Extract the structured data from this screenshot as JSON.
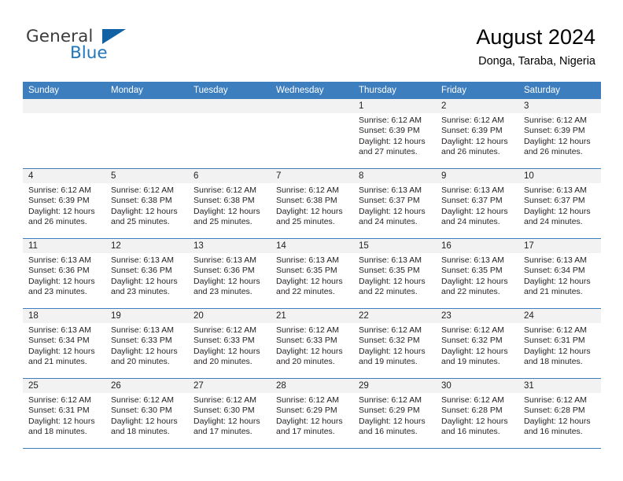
{
  "brand": {
    "name_top": "General",
    "name_bottom": "Blue",
    "triangle_icon": "blue-triangle-logo-mark",
    "color_top": "#3c3c3c",
    "color_bottom": "#2077bc"
  },
  "header": {
    "title": "August 2024",
    "subtitle": "Donga, Taraba, Nigeria"
  },
  "theme": {
    "header_blue": "#3d7ebf",
    "day_head_gray": "#f2f2f2",
    "text": "#231f20"
  },
  "weekdays": [
    "Sunday",
    "Monday",
    "Tuesday",
    "Wednesday",
    "Thursday",
    "Friday",
    "Saturday"
  ],
  "weeks": [
    [
      {
        "date": "",
        "sunrise": "",
        "sunset": "",
        "daylight_1": "",
        "daylight_2": ""
      },
      {
        "date": "",
        "sunrise": "",
        "sunset": "",
        "daylight_1": "",
        "daylight_2": ""
      },
      {
        "date": "",
        "sunrise": "",
        "sunset": "",
        "daylight_1": "",
        "daylight_2": ""
      },
      {
        "date": "",
        "sunrise": "",
        "sunset": "",
        "daylight_1": "",
        "daylight_2": ""
      },
      {
        "date": "1",
        "sunrise": "Sunrise: 6:12 AM",
        "sunset": "Sunset: 6:39 PM",
        "daylight_1": "Daylight: 12 hours",
        "daylight_2": "and 27 minutes."
      },
      {
        "date": "2",
        "sunrise": "Sunrise: 6:12 AM",
        "sunset": "Sunset: 6:39 PM",
        "daylight_1": "Daylight: 12 hours",
        "daylight_2": "and 26 minutes."
      },
      {
        "date": "3",
        "sunrise": "Sunrise: 6:12 AM",
        "sunset": "Sunset: 6:39 PM",
        "daylight_1": "Daylight: 12 hours",
        "daylight_2": "and 26 minutes."
      }
    ],
    [
      {
        "date": "4",
        "sunrise": "Sunrise: 6:12 AM",
        "sunset": "Sunset: 6:39 PM",
        "daylight_1": "Daylight: 12 hours",
        "daylight_2": "and 26 minutes."
      },
      {
        "date": "5",
        "sunrise": "Sunrise: 6:12 AM",
        "sunset": "Sunset: 6:38 PM",
        "daylight_1": "Daylight: 12 hours",
        "daylight_2": "and 25 minutes."
      },
      {
        "date": "6",
        "sunrise": "Sunrise: 6:12 AM",
        "sunset": "Sunset: 6:38 PM",
        "daylight_1": "Daylight: 12 hours",
        "daylight_2": "and 25 minutes."
      },
      {
        "date": "7",
        "sunrise": "Sunrise: 6:12 AM",
        "sunset": "Sunset: 6:38 PM",
        "daylight_1": "Daylight: 12 hours",
        "daylight_2": "and 25 minutes."
      },
      {
        "date": "8",
        "sunrise": "Sunrise: 6:13 AM",
        "sunset": "Sunset: 6:37 PM",
        "daylight_1": "Daylight: 12 hours",
        "daylight_2": "and 24 minutes."
      },
      {
        "date": "9",
        "sunrise": "Sunrise: 6:13 AM",
        "sunset": "Sunset: 6:37 PM",
        "daylight_1": "Daylight: 12 hours",
        "daylight_2": "and 24 minutes."
      },
      {
        "date": "10",
        "sunrise": "Sunrise: 6:13 AM",
        "sunset": "Sunset: 6:37 PM",
        "daylight_1": "Daylight: 12 hours",
        "daylight_2": "and 24 minutes."
      }
    ],
    [
      {
        "date": "11",
        "sunrise": "Sunrise: 6:13 AM",
        "sunset": "Sunset: 6:36 PM",
        "daylight_1": "Daylight: 12 hours",
        "daylight_2": "and 23 minutes."
      },
      {
        "date": "12",
        "sunrise": "Sunrise: 6:13 AM",
        "sunset": "Sunset: 6:36 PM",
        "daylight_1": "Daylight: 12 hours",
        "daylight_2": "and 23 minutes."
      },
      {
        "date": "13",
        "sunrise": "Sunrise: 6:13 AM",
        "sunset": "Sunset: 6:36 PM",
        "daylight_1": "Daylight: 12 hours",
        "daylight_2": "and 23 minutes."
      },
      {
        "date": "14",
        "sunrise": "Sunrise: 6:13 AM",
        "sunset": "Sunset: 6:35 PM",
        "daylight_1": "Daylight: 12 hours",
        "daylight_2": "and 22 minutes."
      },
      {
        "date": "15",
        "sunrise": "Sunrise: 6:13 AM",
        "sunset": "Sunset: 6:35 PM",
        "daylight_1": "Daylight: 12 hours",
        "daylight_2": "and 22 minutes."
      },
      {
        "date": "16",
        "sunrise": "Sunrise: 6:13 AM",
        "sunset": "Sunset: 6:35 PM",
        "daylight_1": "Daylight: 12 hours",
        "daylight_2": "and 22 minutes."
      },
      {
        "date": "17",
        "sunrise": "Sunrise: 6:13 AM",
        "sunset": "Sunset: 6:34 PM",
        "daylight_1": "Daylight: 12 hours",
        "daylight_2": "and 21 minutes."
      }
    ],
    [
      {
        "date": "18",
        "sunrise": "Sunrise: 6:13 AM",
        "sunset": "Sunset: 6:34 PM",
        "daylight_1": "Daylight: 12 hours",
        "daylight_2": "and 21 minutes."
      },
      {
        "date": "19",
        "sunrise": "Sunrise: 6:13 AM",
        "sunset": "Sunset: 6:33 PM",
        "daylight_1": "Daylight: 12 hours",
        "daylight_2": "and 20 minutes."
      },
      {
        "date": "20",
        "sunrise": "Sunrise: 6:12 AM",
        "sunset": "Sunset: 6:33 PM",
        "daylight_1": "Daylight: 12 hours",
        "daylight_2": "and 20 minutes."
      },
      {
        "date": "21",
        "sunrise": "Sunrise: 6:12 AM",
        "sunset": "Sunset: 6:33 PM",
        "daylight_1": "Daylight: 12 hours",
        "daylight_2": "and 20 minutes."
      },
      {
        "date": "22",
        "sunrise": "Sunrise: 6:12 AM",
        "sunset": "Sunset: 6:32 PM",
        "daylight_1": "Daylight: 12 hours",
        "daylight_2": "and 19 minutes."
      },
      {
        "date": "23",
        "sunrise": "Sunrise: 6:12 AM",
        "sunset": "Sunset: 6:32 PM",
        "daylight_1": "Daylight: 12 hours",
        "daylight_2": "and 19 minutes."
      },
      {
        "date": "24",
        "sunrise": "Sunrise: 6:12 AM",
        "sunset": "Sunset: 6:31 PM",
        "daylight_1": "Daylight: 12 hours",
        "daylight_2": "and 18 minutes."
      }
    ],
    [
      {
        "date": "25",
        "sunrise": "Sunrise: 6:12 AM",
        "sunset": "Sunset: 6:31 PM",
        "daylight_1": "Daylight: 12 hours",
        "daylight_2": "and 18 minutes."
      },
      {
        "date": "26",
        "sunrise": "Sunrise: 6:12 AM",
        "sunset": "Sunset: 6:30 PM",
        "daylight_1": "Daylight: 12 hours",
        "daylight_2": "and 18 minutes."
      },
      {
        "date": "27",
        "sunrise": "Sunrise: 6:12 AM",
        "sunset": "Sunset: 6:30 PM",
        "daylight_1": "Daylight: 12 hours",
        "daylight_2": "and 17 minutes."
      },
      {
        "date": "28",
        "sunrise": "Sunrise: 6:12 AM",
        "sunset": "Sunset: 6:29 PM",
        "daylight_1": "Daylight: 12 hours",
        "daylight_2": "and 17 minutes."
      },
      {
        "date": "29",
        "sunrise": "Sunrise: 6:12 AM",
        "sunset": "Sunset: 6:29 PM",
        "daylight_1": "Daylight: 12 hours",
        "daylight_2": "and 16 minutes."
      },
      {
        "date": "30",
        "sunrise": "Sunrise: 6:12 AM",
        "sunset": "Sunset: 6:28 PM",
        "daylight_1": "Daylight: 12 hours",
        "daylight_2": "and 16 minutes."
      },
      {
        "date": "31",
        "sunrise": "Sunrise: 6:12 AM",
        "sunset": "Sunset: 6:28 PM",
        "daylight_1": "Daylight: 12 hours",
        "daylight_2": "and 16 minutes."
      }
    ]
  ]
}
